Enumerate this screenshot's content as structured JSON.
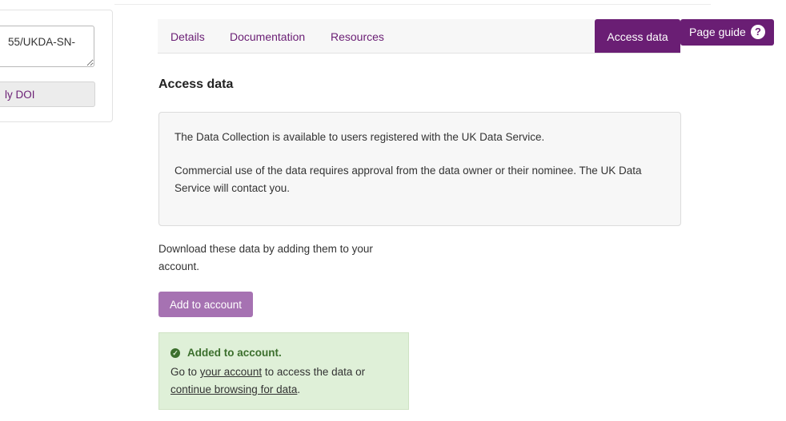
{
  "left_panel": {
    "doi_value": "55/UKDA-SN-",
    "copy_doi_label": "ly DOI"
  },
  "tabs": [
    {
      "label": "Details"
    },
    {
      "label": "Documentation"
    },
    {
      "label": "Resources"
    },
    {
      "label": "Access data",
      "active": true
    }
  ],
  "page_guide": {
    "label": "Page guide",
    "icon": "question-circle-icon"
  },
  "section": {
    "title": "Access data",
    "info_p1": "The Data Collection is available to users registered with the UK Data Service.",
    "info_p2": "Commercial use of the data requires approval from the data owner or their nominee. The UK Data Service will contact you.",
    "download_text": "Download these data by adding them to your account.",
    "add_button": "Add to account"
  },
  "success": {
    "icon": "check-circle-icon",
    "heading": "Added to account.",
    "line1_pre": "Go to ",
    "line1_link": "your account",
    "line1_post": " to access the data or",
    "line2_link": "continue browsing for data",
    "line2_post": "."
  },
  "colors": {
    "brand": "#6a1e74",
    "button_muted": "#a672b2",
    "success_bg": "#dff0d8",
    "success_text": "#3c6f2d"
  }
}
